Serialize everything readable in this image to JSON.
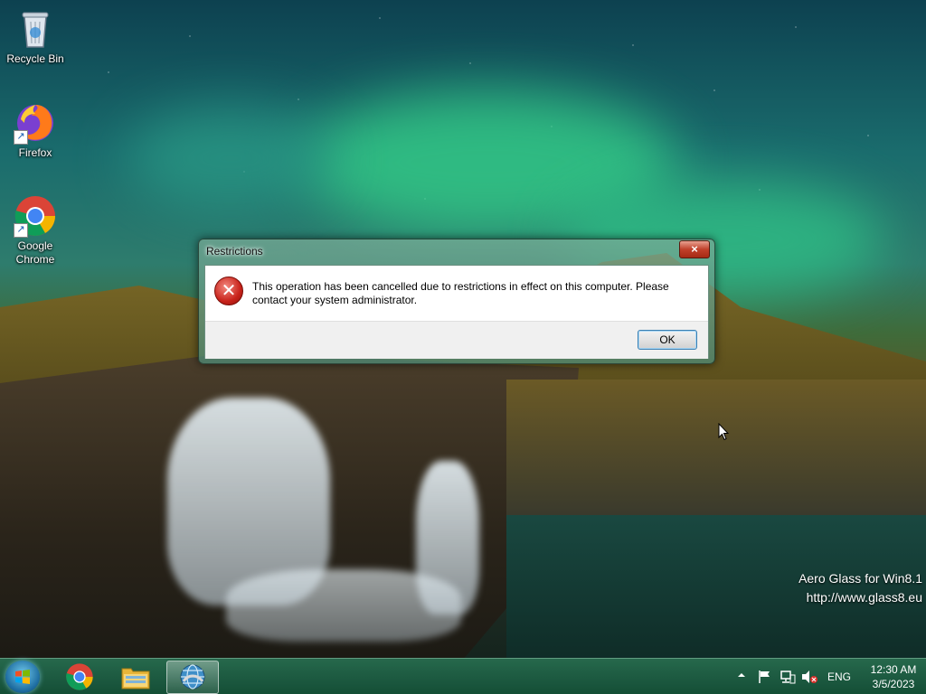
{
  "desktop": {
    "icons": [
      {
        "label": "Recycle Bin",
        "icon": "recycle-bin-icon"
      },
      {
        "label": "Firefox",
        "icon": "firefox-icon"
      },
      {
        "label": "Google Chrome",
        "icon": "chrome-icon"
      }
    ],
    "watermark": {
      "line1": "Aero Glass for Win8.1",
      "line2": "http://www.glass8.eu"
    }
  },
  "dialog": {
    "title": "Restrictions",
    "close_label": "×",
    "icon": "error-icon",
    "message": "This operation has been cancelled due to restrictions in effect on this computer. Please contact your system administrator.",
    "ok_label": "OK"
  },
  "taskbar": {
    "pinned": [
      {
        "name": "chrome",
        "icon": "chrome-icon"
      },
      {
        "name": "file-explorer",
        "icon": "file-explorer-icon"
      },
      {
        "name": "control-panel",
        "icon": "globe-app-icon",
        "active": true
      }
    ],
    "tray": {
      "language": "ENG",
      "time": "12:30 AM",
      "date": "3/5/2023",
      "icons": [
        "show-hidden-icons-icon",
        "action-center-flag-icon",
        "network-icon",
        "volume-muted-icon"
      ]
    }
  },
  "colors": {
    "taskbar": "#1f6b4b",
    "close_button": "#c0402a",
    "error_red": "#c8221a",
    "ok_focus_border": "#3c7fb1"
  }
}
